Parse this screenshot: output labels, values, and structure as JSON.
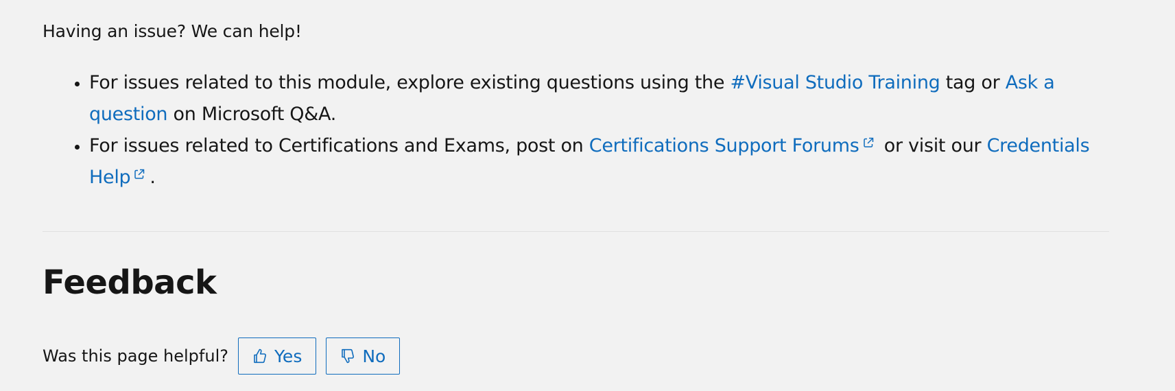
{
  "intro": {
    "text": "Having an issue? We can help!"
  },
  "help_items": [
    {
      "prefix": "For issues related to this module, explore existing questions using the ",
      "link1": "#Visual Studio Training",
      "middle": " tag or ",
      "link2": "Ask a question",
      "suffix": " on Microsoft Q&A."
    },
    {
      "prefix": "For issues related to Certifications and Exams, post on ",
      "link1": "Certifications Support Forums",
      "middle": " or visit our ",
      "link2": "Credentials Help",
      "suffix": "."
    }
  ],
  "feedback": {
    "title": "Feedback",
    "question": "Was this page helpful?",
    "yes_label": "Yes",
    "no_label": "No"
  },
  "colors": {
    "background": "#f2f2f2",
    "text": "#161616",
    "link": "#0f6cbd",
    "divider": "#e0e0e0"
  },
  "icons": {
    "external_link": "external-link-icon",
    "thumbs_up": "thumbs-up-icon",
    "thumbs_down": "thumbs-down-icon"
  }
}
